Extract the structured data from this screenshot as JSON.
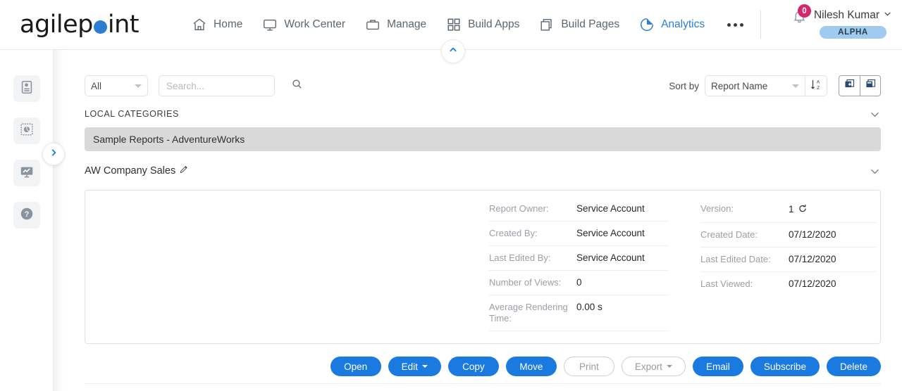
{
  "brand": {
    "logo_part1": "agilep",
    "logo_part2": "int",
    "accent_color": "#2a7fd4"
  },
  "topnav": {
    "items": [
      {
        "label": "Home",
        "icon": "home-icon",
        "active": false
      },
      {
        "label": "Work Center",
        "icon": "monitor-icon",
        "active": false
      },
      {
        "label": "Manage",
        "icon": "briefcase-icon",
        "active": false
      },
      {
        "label": "Build Apps",
        "icon": "grid-icon",
        "active": false
      },
      {
        "label": "Build Pages",
        "icon": "pages-icon",
        "active": false
      },
      {
        "label": "Analytics",
        "icon": "pie-chart-icon",
        "active": true
      }
    ],
    "more_label": "•••",
    "notifications": {
      "count": "0",
      "icon": "bell-icon",
      "badge_color": "#d6256f"
    },
    "user": {
      "name": "Nilesh Kumar",
      "badge": "ALPHA",
      "badge_color": "#9ecbef"
    }
  },
  "leftrail": {
    "items": [
      {
        "icon": "report-icon",
        "name": "reports"
      },
      {
        "icon": "dashboard-icon",
        "name": "dashboards"
      },
      {
        "icon": "chart-monitor-icon",
        "name": "analytics"
      },
      {
        "icon": "help-icon",
        "name": "help"
      }
    ],
    "expand_icon": "chevron-right-icon"
  },
  "toolbar": {
    "filter_value": "All",
    "search_placeholder": "Search...",
    "search_value": "",
    "sort_label": "Sort by",
    "sort_value": "Report Name",
    "sort_direction_icon": "sort-az-descending-icon",
    "expand_all_icon": "expand-all-icon",
    "collapse_all_icon": "collapse-all-icon"
  },
  "categories": {
    "header": "LOCAL CATEGORIES",
    "rows": [
      {
        "label": "Sample Reports - AdventureWorks",
        "selected": true
      }
    ]
  },
  "report": {
    "name": "AW Company Sales",
    "edit_icon": "pencil-icon",
    "meta_left": [
      {
        "key": "Report Owner:",
        "value": "Service Account"
      },
      {
        "key": "Created By:",
        "value": "Service Account"
      },
      {
        "key": "Last Edited By:",
        "value": "Service Account"
      },
      {
        "key": "Number of Views:",
        "value": "0"
      },
      {
        "key": "Average Rendering Time:",
        "value": "0.00 s"
      }
    ],
    "meta_right": [
      {
        "key": "Version:",
        "value": "1",
        "icon": "history-revert-icon"
      },
      {
        "key": "Created Date:",
        "value": "07/12/2020"
      },
      {
        "key": "Last Edited Date:",
        "value": "07/12/2020"
      },
      {
        "key": "Last Viewed:",
        "value": "07/12/2020"
      }
    ]
  },
  "actions": [
    {
      "label": "Open",
      "style": "primary",
      "dropdown": false
    },
    {
      "label": "Edit",
      "style": "primary",
      "dropdown": true
    },
    {
      "label": "Copy",
      "style": "primary",
      "dropdown": false
    },
    {
      "label": "Move",
      "style": "primary",
      "dropdown": false
    },
    {
      "label": "Print",
      "style": "ghost",
      "dropdown": false
    },
    {
      "label": "Export",
      "style": "ghost",
      "dropdown": true
    },
    {
      "label": "Email",
      "style": "primary",
      "dropdown": false
    },
    {
      "label": "Subscribe",
      "style": "primary",
      "dropdown": false
    },
    {
      "label": "Delete",
      "style": "primary",
      "dropdown": false
    }
  ]
}
